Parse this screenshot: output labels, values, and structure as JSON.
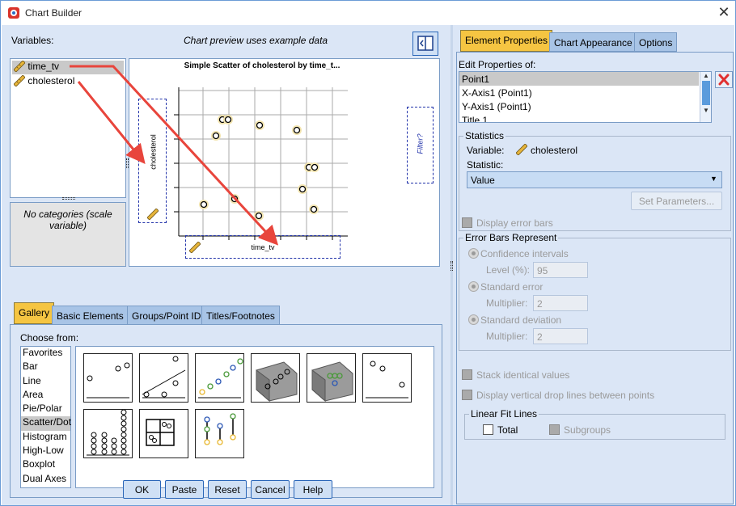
{
  "window": {
    "title": "Chart Builder",
    "close_glyph": "✕"
  },
  "variables": {
    "label": "Variables:",
    "items": [
      "time_tv",
      "cholesterol"
    ],
    "no_categories": "No categories (scale variable)"
  },
  "preview": {
    "caption": "Chart preview uses example data",
    "chart_title": "Simple Scatter of cholesterol by time_t...",
    "y_drop_label": "cholesterol",
    "x_drop_label": "time_tv",
    "filter_label": "Filter?"
  },
  "gallery_tabs": [
    "Gallery",
    "Basic Elements",
    "Groups/Point ID",
    "Titles/Footnotes"
  ],
  "gallery": {
    "choose_from": "Choose from:",
    "types": [
      "Favorites",
      "Bar",
      "Line",
      "Area",
      "Pie/Polar",
      "Scatter/Dot",
      "Histogram",
      "High-Low",
      "Boxplot",
      "Dual Axes"
    ],
    "selected": "Scatter/Dot"
  },
  "buttons": {
    "ok": "OK",
    "paste": "Paste",
    "reset": "Reset",
    "cancel": "Cancel",
    "help": "Help"
  },
  "right_tabs": [
    "Element Properties",
    "Chart Appearance",
    "Options"
  ],
  "properties": {
    "edit_label": "Edit Properties of:",
    "list": [
      "Point1",
      "X-Axis1 (Point1)",
      "Y-Axis1 (Point1)",
      "Title 1"
    ],
    "statistics_group": "Statistics",
    "variable_label": "Variable:",
    "variable_value": "cholesterol",
    "statistic_label": "Statistic:",
    "statistic_value": "Value",
    "set_parameters": "Set Parameters...",
    "display_error_bars": "Display error bars",
    "error_bars_group": "Error Bars Represent",
    "confidence_intervals": "Confidence intervals",
    "level_label": "Level (%):",
    "level_value": "95",
    "standard_error": "Standard error",
    "multiplier_label": "Multiplier:",
    "se_multiplier": "2",
    "standard_deviation": "Standard deviation",
    "sd_multiplier": "2",
    "stack_identical": "Stack identical values",
    "drop_lines": "Display vertical drop lines between points",
    "linear_fit_group": "Linear Fit Lines",
    "total": "Total",
    "subgroups": "Subgroups"
  },
  "colors": {
    "accent_tab": "#f5c542",
    "panel_bg": "#dbe6f6",
    "arrow": "#e8453c",
    "delete": "#e03030"
  }
}
